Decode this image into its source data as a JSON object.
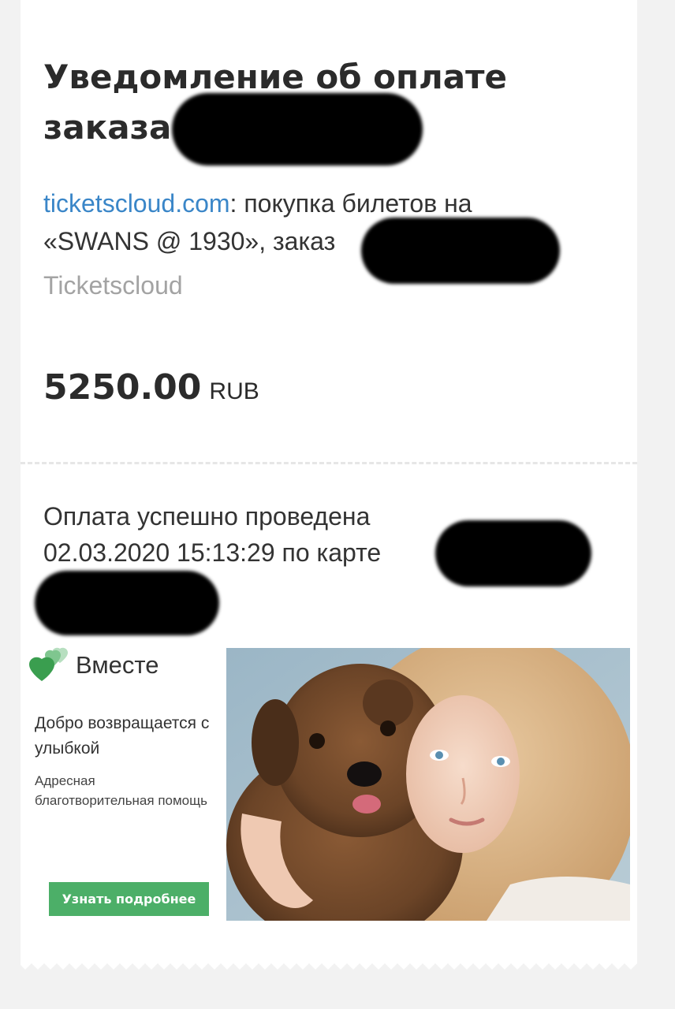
{
  "email": {
    "title": "Уведомление об оплате заказа",
    "merchant_link": "ticketscloud.com",
    "description": ": покупка билетов на «SWANS @ 1930», заказ",
    "merchant_name": "Ticketscloud",
    "amount": "5250.00",
    "currency": "RUB",
    "status_line1": "Оплата успешно проведена",
    "status_line2": "02.03.2020 15:13:29 по карте"
  },
  "ad": {
    "brand": "Вместе",
    "headline": "Добро возвращается с улыбкой",
    "subtitle": "Адресная благотворительная помощь",
    "button_label": "Узнать подробнее",
    "accent_color": "#4caf68"
  },
  "colors": {
    "link": "#3a86c8",
    "text": "#2b2b2b",
    "muted": "#a3a3a3",
    "background": "#f2f2f2"
  }
}
